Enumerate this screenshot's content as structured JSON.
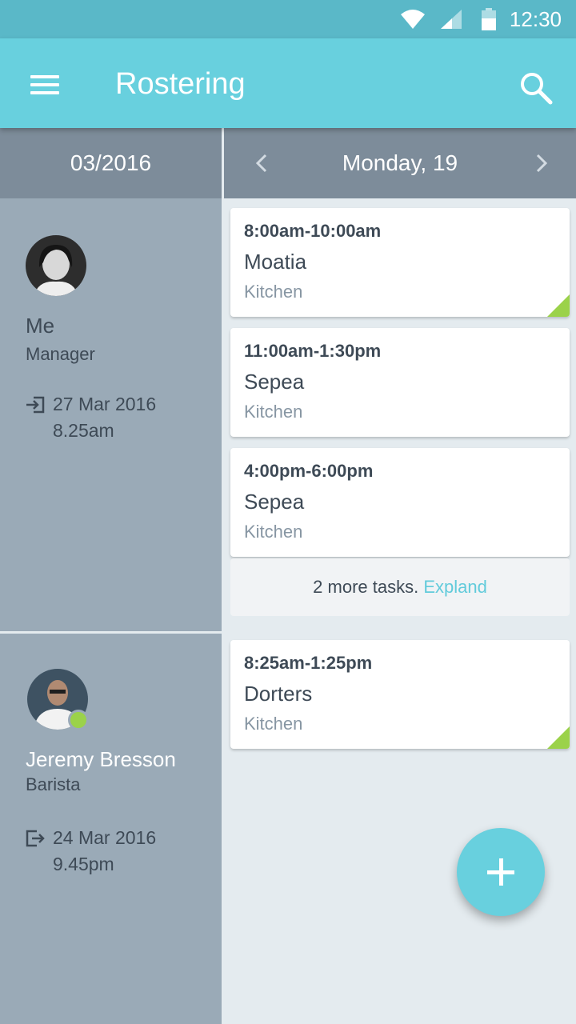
{
  "status_bar": {
    "time": "12:30"
  },
  "app_bar": {
    "title": "Rostering"
  },
  "date_bar": {
    "month": "03/2016",
    "day": "Monday, 19"
  },
  "employees": [
    {
      "name": "Me",
      "role": "Manager",
      "clock_icon": "clock-in-icon",
      "date": "27 Mar 2016",
      "time": "8.25am",
      "online": false
    },
    {
      "name": "Jeremy Bresson",
      "role": "Barista",
      "clock_icon": "clock-out-icon",
      "date": "24 Mar 2016",
      "time": "9.45pm",
      "online": true
    }
  ],
  "shifts": [
    {
      "time": "8:00am-10:00am",
      "place": "Moatia",
      "area": "Kitchen",
      "corner": true
    },
    {
      "time": "11:00am-1:30pm",
      "place": "Sepea",
      "area": "Kitchen",
      "corner": false
    },
    {
      "time": "4:00pm-6:00pm",
      "place": "Sepea",
      "area": "Kitchen",
      "corner": false
    },
    {
      "time": "8:25am-1:25pm",
      "place": "Dorters",
      "area": "Kitchen",
      "corner": true
    }
  ],
  "more_tasks": {
    "text": "2 more tasks.",
    "link": "Expland"
  },
  "colors": {
    "primary": "#68d0de",
    "status_bar": "#5ab8c8",
    "date_bar": "#7d8c9a",
    "sidebar": "#9aaab7",
    "accent_green": "#9bd24a"
  }
}
